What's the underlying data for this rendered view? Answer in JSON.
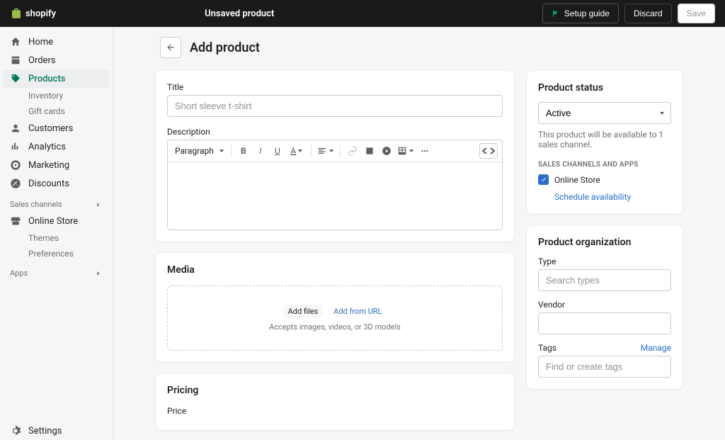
{
  "topbar": {
    "brand": "shopify",
    "title": "Unsaved product",
    "setup": "Setup guide",
    "discard": "Discard",
    "save": "Save"
  },
  "nav": {
    "home": "Home",
    "orders": "Orders",
    "products": "Products",
    "inventory": "Inventory",
    "giftcards": "Gift cards",
    "customers": "Customers",
    "analytics": "Analytics",
    "marketing": "Marketing",
    "discounts": "Discounts",
    "sales_section": "Sales channels",
    "online_store": "Online Store",
    "themes": "Themes",
    "preferences": "Preferences",
    "apps_section": "Apps",
    "settings": "Settings"
  },
  "page": {
    "title": "Add product"
  },
  "form": {
    "title_label": "Title",
    "title_placeholder": "Short sleeve t-shirt",
    "description_label": "Description",
    "rte_format": "Paragraph"
  },
  "media": {
    "heading": "Media",
    "add_files": "Add files",
    "add_url": "Add from URL",
    "hint": "Accepts images, videos, or 3D models"
  },
  "pricing": {
    "heading": "Pricing",
    "price_label": "Price"
  },
  "status": {
    "heading": "Product status",
    "value": "Active",
    "helper": "This product will be available to 1 sales channel.",
    "channels_heading": "Sales channels and apps",
    "channel": "Online Store",
    "schedule": "Schedule availability"
  },
  "org": {
    "heading": "Product organization",
    "type_label": "Type",
    "type_placeholder": "Search types",
    "vendor_label": "Vendor",
    "tags_label": "Tags",
    "tags_manage": "Manage",
    "tags_placeholder": "Find or create tags"
  }
}
